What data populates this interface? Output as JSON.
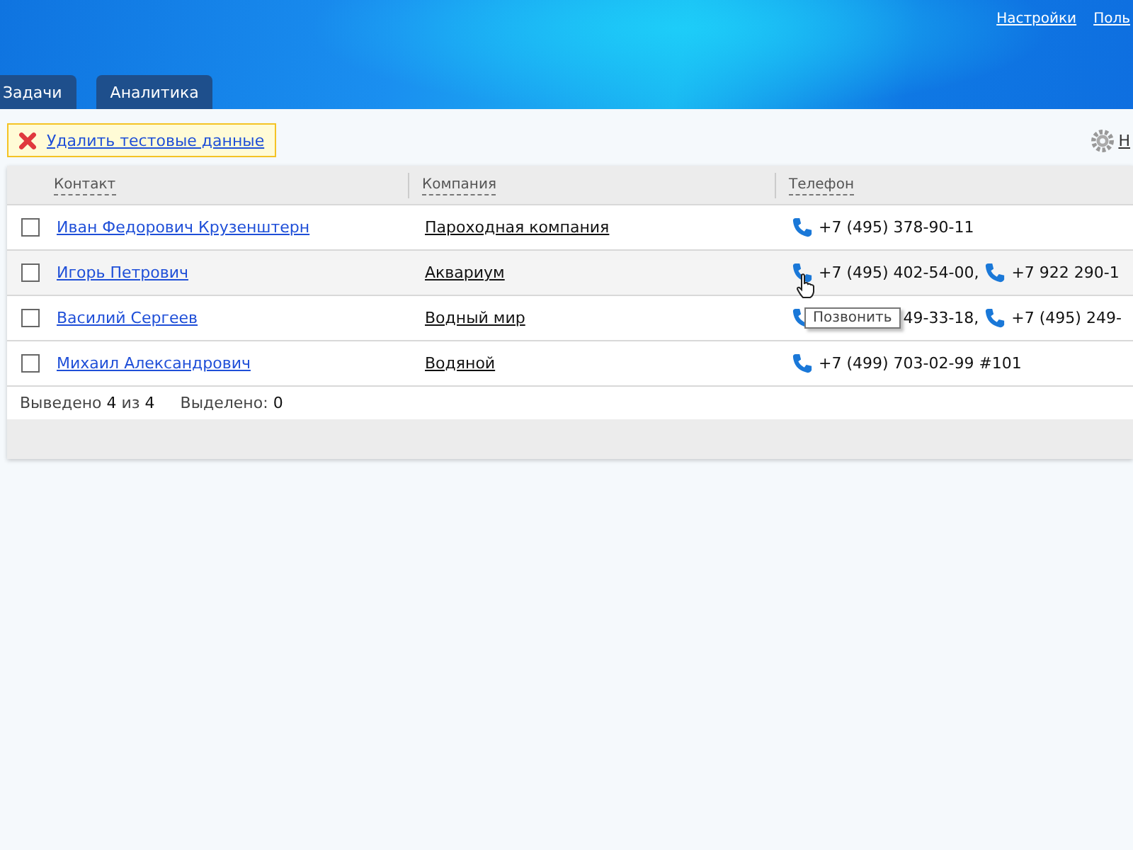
{
  "header": {
    "links": [
      "Настройки",
      "Поль"
    ]
  },
  "tabs": [
    {
      "label": "Задачи",
      "selected": false
    },
    {
      "label": "Аналитика",
      "selected": false
    }
  ],
  "toolbar": {
    "notice": "Удалить тестовые данные",
    "settings_label": "Н"
  },
  "table": {
    "columns": [
      "Контакт",
      "Компания",
      "Телефон"
    ],
    "rows": [
      {
        "checked": false,
        "hovered": false,
        "contact": "Иван Федорович Крузенштерн",
        "company": "Пароходная компания",
        "phones": [
          "+7 (495) 378-90-11"
        ]
      },
      {
        "checked": false,
        "hovered": true,
        "contact": "Игорь Петрович",
        "company": "Аквариум",
        "phones": [
          "+7 (495) 402-54-00,",
          "+7 922 290-1"
        ]
      },
      {
        "checked": false,
        "hovered": false,
        "contact": "Василий Сергеев",
        "company": "Водный мир",
        "phones": [
          "49-33-18,",
          "+7 (495) 249-"
        ]
      },
      {
        "checked": false,
        "hovered": false,
        "contact": "Михаил Александрович",
        "company": "Водяной",
        "phones": [
          "+7 (499) 703-02-99 #101"
        ]
      }
    ],
    "footer": {
      "shown_label": "Выведено",
      "shown": "4",
      "of_label": "из",
      "total": "4",
      "selected_label": "Выделено:",
      "selected": "0"
    }
  },
  "tooltip": "Позвонить"
}
